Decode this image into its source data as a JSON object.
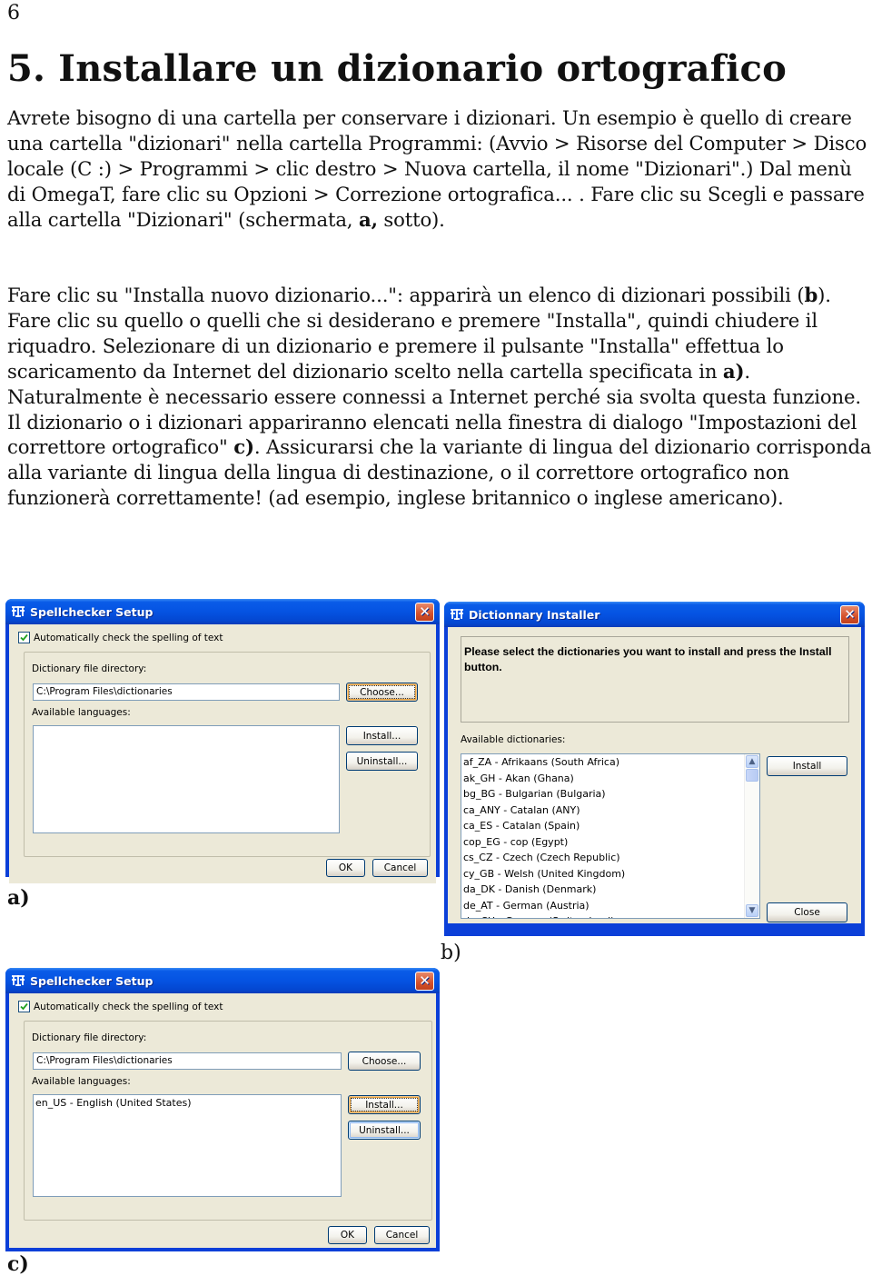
{
  "page_number": "6",
  "heading": "5. Installare un dizionario ortografico",
  "paragraph1": {
    "part1": "Avrete bisogno di una cartella per conservare i dizionari. Un esempio è quello di creare una cartella \"dizionari\" nella cartella Programmi: (Avvio > Risorse del Computer >  Disco locale (C :) > Programmi > clic destro > Nuova cartella, il nome \"Dizionari\".) Dal menù di OmegaT, fare clic su Opzioni > Correzione ortografica... . Fare clic su Scegli e passare alla cartella \"Dizionari\" (schermata, ",
    "bold1": "a,",
    "part2": " sotto)."
  },
  "paragraph2": {
    "part1": "Fare clic su \"Installa nuovo dizionario...\": apparirà un elenco di dizionari possibili (",
    "bold1": "b",
    "part2": "). Fare clic su quello o quelli che si desiderano e premere \"Installa\", quindi chiudere il riquadro. Selezionare di un dizionario e premere il pulsante \"Installa\" effettua lo scaricamento da Internet del dizionario scelto nella cartella specificata in ",
    "bold2": "a)",
    "part3": ". Naturalmente è necessario essere connessi a Internet perché sia svolta questa funzione.  Il dizionario o i dizionari appariranno elencati nella finestra di dialogo \"Impostazioni del correttore ortografico\" ",
    "bold3": "c)",
    "part4": ". Assicurarsi che la variante di lingua del dizionario corrisponda alla variante di lingua della lingua di destinazione, o il correttore ortografico non funzionerà correttamente! (ad esempio, inglese britannico o inglese americano)."
  },
  "captions": {
    "a": "a)",
    "b": "b)",
    "c": "c)"
  },
  "colors": {
    "titlebar": "#0553e2",
    "dialog_bg": "#ece9d8",
    "close_button": "#d4502a",
    "field_border": "#7f9db9"
  },
  "dialog_a": {
    "title": "Spellchecker Setup",
    "icon": "omegat-icon",
    "checkbox_label": "Automatically check the spelling of text",
    "checkbox_checked": true,
    "dir_label": "Dictionary file directory:",
    "dir_value": "C:\\Program Files\\dictionaries",
    "choose_label": "Choose...",
    "languages_label": "Available languages:",
    "languages": [],
    "install_label": "Install...",
    "uninstall_label": "Uninstall...",
    "ok_label": "OK",
    "cancel_label": "Cancel"
  },
  "dialog_b": {
    "title": "Dictionnary Installer",
    "icon": "omegat-icon",
    "info_text": "Please select the dictionaries you want to install and press the Install button.",
    "list_label": "Available dictionaries:",
    "dictionaries": [
      "af_ZA - Afrikaans (South Africa)",
      "ak_GH - Akan (Ghana)",
      "bg_BG - Bulgarian (Bulgaria)",
      "ca_ANY - Catalan (ANY)",
      "ca_ES - Catalan (Spain)",
      "cop_EG - cop (Egypt)",
      "cs_CZ - Czech (Czech Republic)",
      "cy_GB - Welsh (United Kingdom)",
      "da_DK - Danish (Denmark)",
      "de_AT - German (Austria)",
      "de_CH - German (Switzerland)"
    ],
    "install_label": "Install",
    "close_label": "Close"
  },
  "dialog_c": {
    "title": "Spellchecker Setup",
    "icon": "omegat-icon",
    "checkbox_label": "Automatically check the spelling of text",
    "checkbox_checked": true,
    "dir_label": "Dictionary file directory:",
    "dir_value": "C:\\Program Files\\dictionaries",
    "choose_label": "Choose...",
    "languages_label": "Available languages:",
    "languages": [
      "en_US - English (United States)"
    ],
    "install_label": "Install...",
    "uninstall_label": "Uninstall...",
    "ok_label": "OK",
    "cancel_label": "Cancel"
  }
}
